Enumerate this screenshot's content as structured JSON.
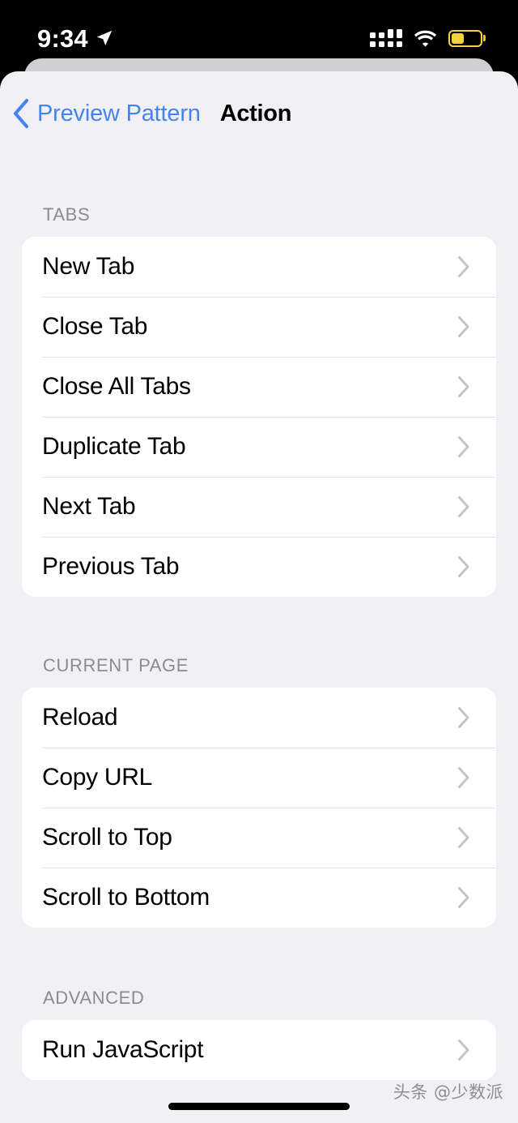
{
  "status_bar": {
    "time": "9:34",
    "location_icon": "location-arrow-icon",
    "cellular_icon": "cellular-signal-icon",
    "wifi_icon": "wifi-icon",
    "battery_icon": "battery-low-power-icon",
    "battery_level_percent": 45,
    "battery_color": "#f5d33c"
  },
  "nav": {
    "back_label": "Preview Pattern",
    "back_icon": "chevron-left-icon",
    "title": "Action",
    "accent_color": "#4783f0"
  },
  "sections": [
    {
      "header": "TABS",
      "rows": [
        {
          "label": "New Tab"
        },
        {
          "label": "Close Tab"
        },
        {
          "label": "Close All Tabs"
        },
        {
          "label": "Duplicate Tab"
        },
        {
          "label": "Next Tab"
        },
        {
          "label": "Previous Tab"
        }
      ]
    },
    {
      "header": "CURRENT PAGE",
      "rows": [
        {
          "label": "Reload"
        },
        {
          "label": "Copy URL"
        },
        {
          "label": "Scroll to Top"
        },
        {
          "label": "Scroll to Bottom"
        }
      ]
    },
    {
      "header": "ADVANCED",
      "rows": [
        {
          "label": "Run JavaScript"
        }
      ]
    }
  ],
  "footer": {
    "watermark": "头条 @少数派",
    "home_indicator": "home-indicator"
  },
  "theme": {
    "background": "#f1f1f5",
    "card_background": "#ffffff",
    "separator": "#e4e4e8",
    "header_text": "#8b8b90",
    "chevron": "#c3c3c8"
  }
}
